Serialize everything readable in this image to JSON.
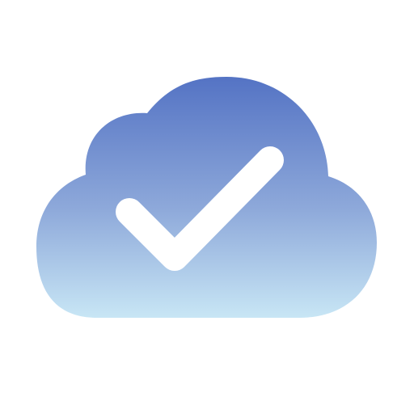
{
  "icon": {
    "name": "cloud-checkmark-icon",
    "colors": {
      "cloud_top": "#5473c4",
      "cloud_middle": "#8ea9da",
      "cloud_bottom": "#c8e6f5",
      "checkmark": "#ffffff",
      "background": "#ffffff"
    }
  }
}
